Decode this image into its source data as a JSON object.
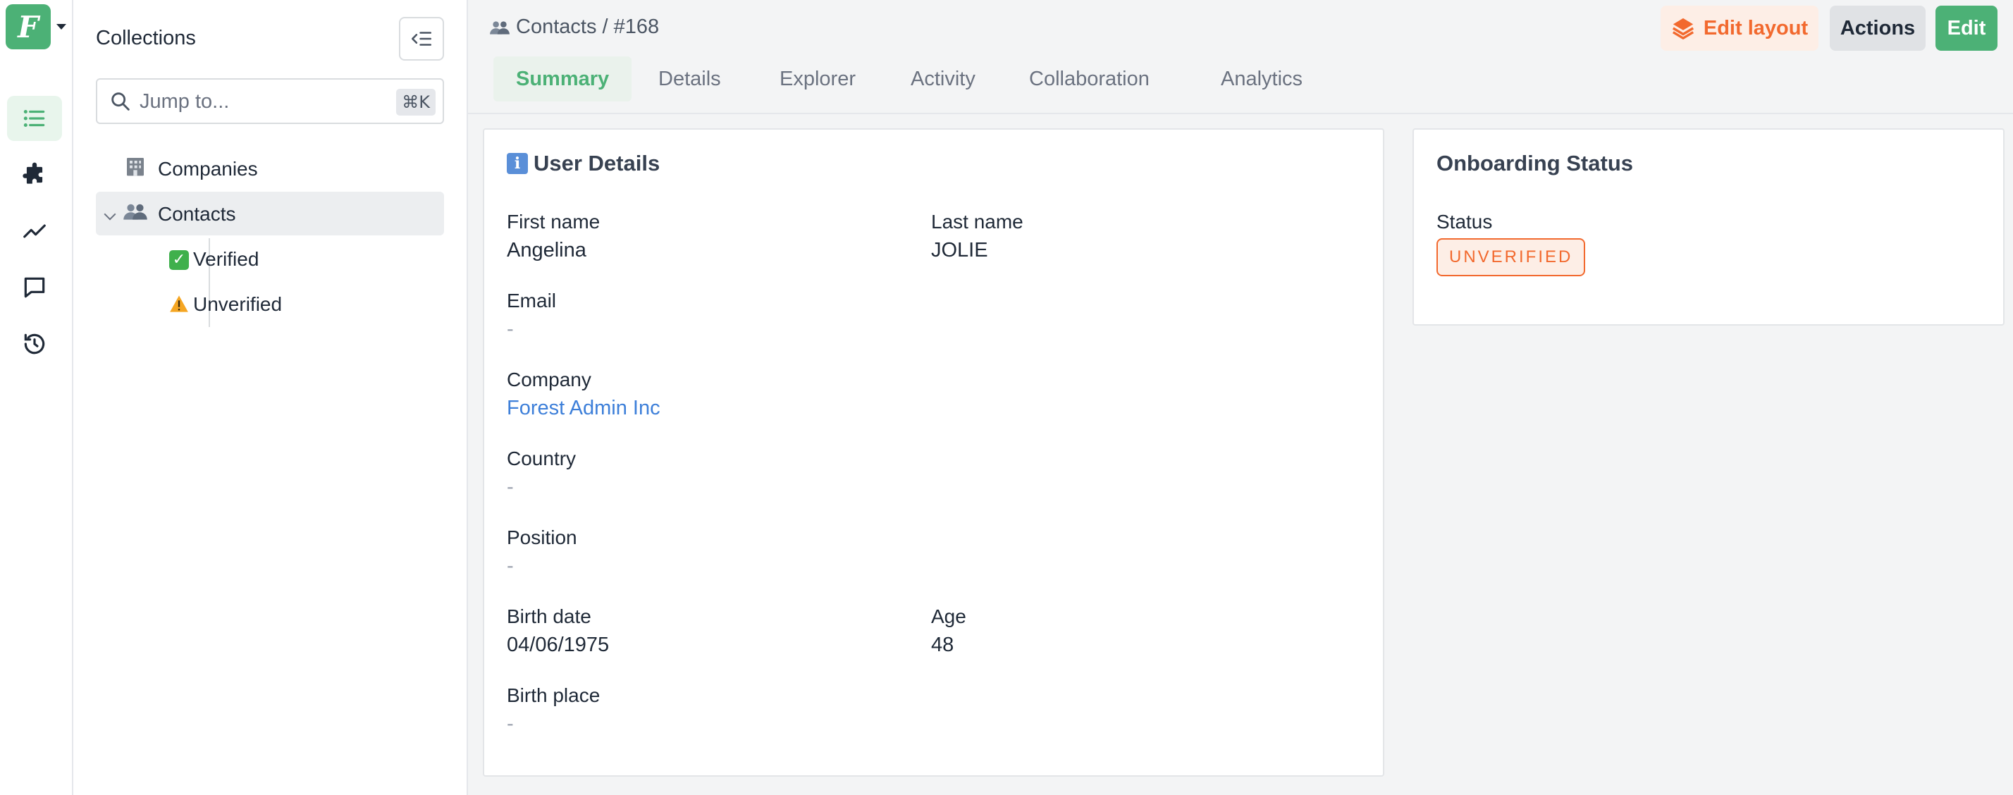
{
  "app": {
    "brand_color": "#4cb176",
    "logo_letter": "F"
  },
  "rail": {
    "items": [
      {
        "icon": "list-icon",
        "active": true
      },
      {
        "icon": "puzzle-icon",
        "active": false
      },
      {
        "icon": "chart-line-icon",
        "active": false
      },
      {
        "icon": "chat-icon",
        "active": false
      },
      {
        "icon": "history-icon",
        "active": false
      }
    ]
  },
  "sidebar": {
    "title": "Collections",
    "search_placeholder": "Jump to...",
    "search_shortcut": "⌘K",
    "items": [
      {
        "label": "Companies",
        "icon": "building-icon"
      },
      {
        "label": "Contacts",
        "icon": "people-icon",
        "selected": true,
        "expanded": true
      },
      {
        "label": "Verified",
        "icon": "check-icon",
        "child": true
      },
      {
        "label": "Unverified",
        "icon": "warning-icon",
        "child": true
      }
    ]
  },
  "header": {
    "breadcrumb": "Contacts / #168",
    "edit_layout_label": "Edit layout",
    "actions_label": "Actions",
    "edit_label": "Edit"
  },
  "tabs": [
    "Summary",
    "Details",
    "Explorer",
    "Activity",
    "Collaboration",
    "Analytics"
  ],
  "active_tab": "Summary",
  "user_details": {
    "title": "User Details",
    "fields": {
      "first_name": {
        "label": "First name",
        "value": "Angelina"
      },
      "last_name": {
        "label": "Last name",
        "value": "JOLIE"
      },
      "email": {
        "label": "Email",
        "value": "-"
      },
      "company": {
        "label": "Company",
        "value": "Forest Admin Inc"
      },
      "country": {
        "label": "Country",
        "value": "-"
      },
      "position": {
        "label": "Position",
        "value": "-"
      },
      "birth_date": {
        "label": "Birth date",
        "value": "04/06/1975"
      },
      "age": {
        "label": "Age",
        "value": "48"
      },
      "birth_place": {
        "label": "Birth place",
        "value": "-"
      }
    }
  },
  "onboarding": {
    "title": "Onboarding Status",
    "status_label": "Status",
    "status_value": "UNVERIFIED",
    "status_color": "#f2692e"
  }
}
